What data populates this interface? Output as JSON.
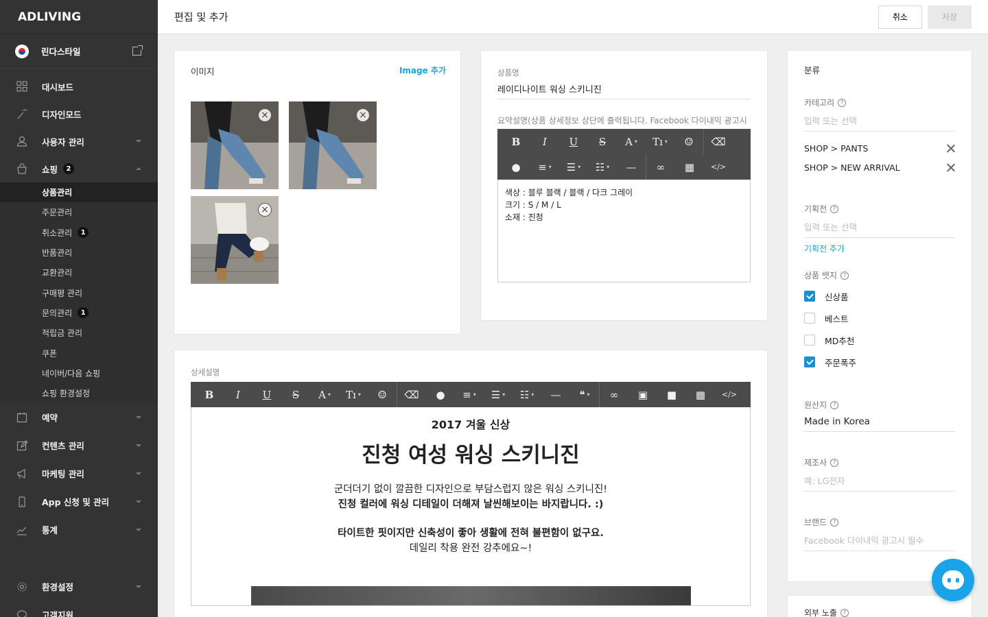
{
  "brand": "ADLIVING",
  "site": {
    "name": "린다스타일"
  },
  "nav": [
    {
      "key": "dashboard",
      "label": "대시보드",
      "icon": "dashboard-icon"
    },
    {
      "key": "design",
      "label": "디자인모드",
      "icon": "magic-wand-icon"
    },
    {
      "key": "users",
      "label": "사용자 관리",
      "icon": "user-icon",
      "caret": "down"
    },
    {
      "key": "shop",
      "label": "쇼핑",
      "icon": "shopping-bag-icon",
      "badge": "2",
      "caret": "up"
    }
  ],
  "shop_sub": [
    {
      "label": "상품관리",
      "active": true
    },
    {
      "label": "주문관리"
    },
    {
      "label": "취소관리",
      "badge": "1"
    },
    {
      "label": "반품관리"
    },
    {
      "label": "교환관리"
    },
    {
      "label": "구매평 관리"
    },
    {
      "label": "문의관리",
      "badge": "1"
    },
    {
      "label": "적립금 관리"
    },
    {
      "label": "쿠폰"
    },
    {
      "label": "네이버/다음 쇼핑"
    },
    {
      "label": "쇼핑 환경설정"
    }
  ],
  "nav2": [
    {
      "key": "reservation",
      "label": "예약",
      "icon": "calendar-icon"
    },
    {
      "key": "contents",
      "label": "컨텐츠 관리",
      "icon": "edit-icon"
    },
    {
      "key": "marketing",
      "label": "마케팅 관리",
      "icon": "megaphone-icon"
    },
    {
      "key": "app",
      "label": "App 신청 및 관리",
      "icon": "mobile-icon"
    },
    {
      "key": "stats",
      "label": "통계",
      "icon": "chart-icon"
    }
  ],
  "nav3": [
    {
      "key": "settings",
      "label": "환경설정",
      "icon": "gear-icon"
    },
    {
      "key": "support",
      "label": "고객지원",
      "icon": "chat-icon"
    }
  ],
  "header": {
    "title": "편집 및 추가",
    "cancel": "취소",
    "save": "저장"
  },
  "images": {
    "title": "이미지",
    "add": "Image 추가"
  },
  "product": {
    "name_label": "상품명",
    "name_value": "레이디나이트 워싱 스키니진",
    "summary_label": "요약설명(상품 상세정보 상단에 출력됩니다. Facebook 다이내믹 광고시 필수)",
    "summary_lines": [
      "색상 : 블루 블랙 / 블랙 / 다크 그레이",
      "크기 : S / M / L",
      "소재 : 진청"
    ]
  },
  "detail": {
    "label": "상세설명",
    "h3": "2017 겨울 신상",
    "h1": "진청 여성 워싱 스키니진",
    "p1": "군더더기 없이 깔끔한 디자인으로 부담스럽지 않은 워싱 스키니진!",
    "p2": "진청 컬러에 워싱 디테일이 더해져 날씬해보이는 바지랍니다. :)",
    "p3": "타이트한 핏이지만 신축성이 좋아 생활에 전혀 불편함이 없구요.",
    "p4": "데일리 착용 완전 강추에요~!"
  },
  "classify": {
    "title": "분류",
    "category_label": "카테고리",
    "category_placeholder": "입력 또는 선택",
    "categories": [
      "SHOP > PANTS",
      "SHOP > NEW ARRIVAL"
    ],
    "promo_label": "기획전",
    "promo_placeholder": "입력 또는 선택",
    "promo_add": "기획전 추가",
    "badge_label": "상품 뱃지",
    "badges": [
      {
        "label": "신상품",
        "checked": true
      },
      {
        "label": "베스트",
        "checked": false
      },
      {
        "label": "MD추천",
        "checked": false
      },
      {
        "label": "주문폭주",
        "checked": true
      }
    ],
    "origin_label": "원산지",
    "origin_value": "Made in Korea",
    "maker_label": "제조사",
    "maker_placeholder": "예: LG전자",
    "brand_label": "브랜드",
    "brand_placeholder": "Facebook 다이내믹 광고시 필수"
  },
  "exposure": {
    "title": "외부 노출"
  },
  "colors": {
    "accent": "#1aa3d8",
    "sidebar": "#333333",
    "check": "#1a8fd1"
  }
}
